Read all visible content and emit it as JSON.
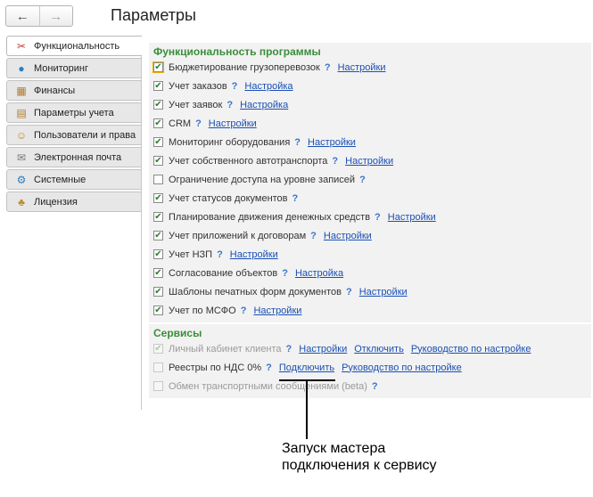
{
  "title": "Параметры",
  "nav": {
    "back_icon": "←",
    "forward_icon": "→"
  },
  "tabs": [
    {
      "label": "Функциональность",
      "icon": "✂"
    },
    {
      "label": "Мониторинг",
      "icon": "●"
    },
    {
      "label": "Финансы",
      "icon": "▦"
    },
    {
      "label": "Параметры учета",
      "icon": "▤"
    },
    {
      "label": "Пользователи и права",
      "icon": "☺"
    },
    {
      "label": "Электронная почта",
      "icon": "✉"
    },
    {
      "label": "Системные",
      "icon": "⚙"
    },
    {
      "label": "Лицензия",
      "icon": "♣"
    }
  ],
  "features": {
    "title": "Функциональность программы",
    "items": [
      {
        "label": "Бюджетирование грузоперевозок",
        "link": "Настройки"
      },
      {
        "label": "Учет заказов",
        "link": "Настройка"
      },
      {
        "label": "Учет заявок",
        "link": "Настройка"
      },
      {
        "label": "CRM",
        "link": "Настройки"
      },
      {
        "label": "Мониторинг оборудования",
        "link": "Настройки"
      },
      {
        "label": "Учет собственного автотранспорта",
        "link": "Настройки"
      },
      {
        "label": "Ограничение доступа на уровне записей",
        "link": ""
      },
      {
        "label": "Учет статусов документов",
        "link": ""
      },
      {
        "label": "Планирование движения денежных средств",
        "link": "Настройки"
      },
      {
        "label": "Учет приложений к договорам",
        "link": "Настройки"
      },
      {
        "label": "Учет НЗП",
        "link": "Настройки"
      },
      {
        "label": "Согласование объектов",
        "link": "Настройка"
      },
      {
        "label": "Шаблоны печатных форм документов",
        "link": "Настройки"
      },
      {
        "label": "Учет по МСФО",
        "link": "Настройки"
      }
    ]
  },
  "services": {
    "title": "Сервисы",
    "items": [
      {
        "label": "Личный кабинет клиента",
        "links": [
          "Настройки",
          "Отключить",
          "Руководство по настройке"
        ]
      },
      {
        "label": "Реестры по НДС 0%",
        "links": [
          "Подключить",
          "Руководство по настройке"
        ]
      },
      {
        "label": "Обмен транспортными сообщениями (beta)",
        "links": []
      }
    ]
  },
  "help_icon": "?",
  "check_icon": "✔",
  "callout": {
    "line1": "Запуск мастера",
    "line2": "подключения к сервису"
  }
}
